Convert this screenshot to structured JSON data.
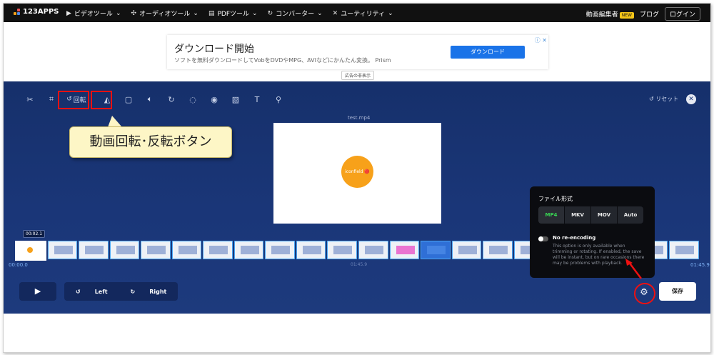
{
  "topbar": {
    "logo": "123APPS",
    "nav": [
      {
        "label": "ビデオツール",
        "icon": "play-icon"
      },
      {
        "label": "オーディオツール",
        "icon": "audio-icon"
      },
      {
        "label": "PDFツール",
        "icon": "pdf-icon"
      },
      {
        "label": "コンバーター",
        "icon": "convert-icon"
      },
      {
        "label": "ユーティリティ",
        "icon": "tools-icon"
      }
    ],
    "editor_link": "動画編集者",
    "new_badge": "NEW",
    "blog": "ブログ",
    "login": "ログイン"
  },
  "ad": {
    "title": "ダウンロード開始",
    "text": "ソフトを無料ダウンロードしてVobをDVDやMPG、AVIなどにかんたん変換。 Prism",
    "button": "ダウンロード",
    "close": "ⓘ ✕",
    "hide": "広告の非表示"
  },
  "editor": {
    "rotate_label": "回転",
    "reset": "リセット",
    "filename": "test.mp4",
    "video_logo": "iconfield 🔴",
    "callout": "動画回転･反転ボタン",
    "cursor_time": "00:02.1",
    "time_start": "00:00.0",
    "time_mid": "01:45.9",
    "time_end": "01:45.9",
    "left": "Left",
    "right": "Right",
    "save": "保存"
  },
  "popup": {
    "title": "ファイル形式",
    "formats": [
      "MP4",
      "MKV",
      "MOV",
      "Auto"
    ],
    "active_format": "MP4",
    "no_reencoding": "No re-encoding",
    "description": "This option is only available when trimming or rotating. If enabled, the save will be instant, but on rare occasions there may be problems with playback."
  },
  "colors": {
    "editor_bg": "#1a3678",
    "highlight": "#e11111",
    "active_format": "#39d353"
  }
}
